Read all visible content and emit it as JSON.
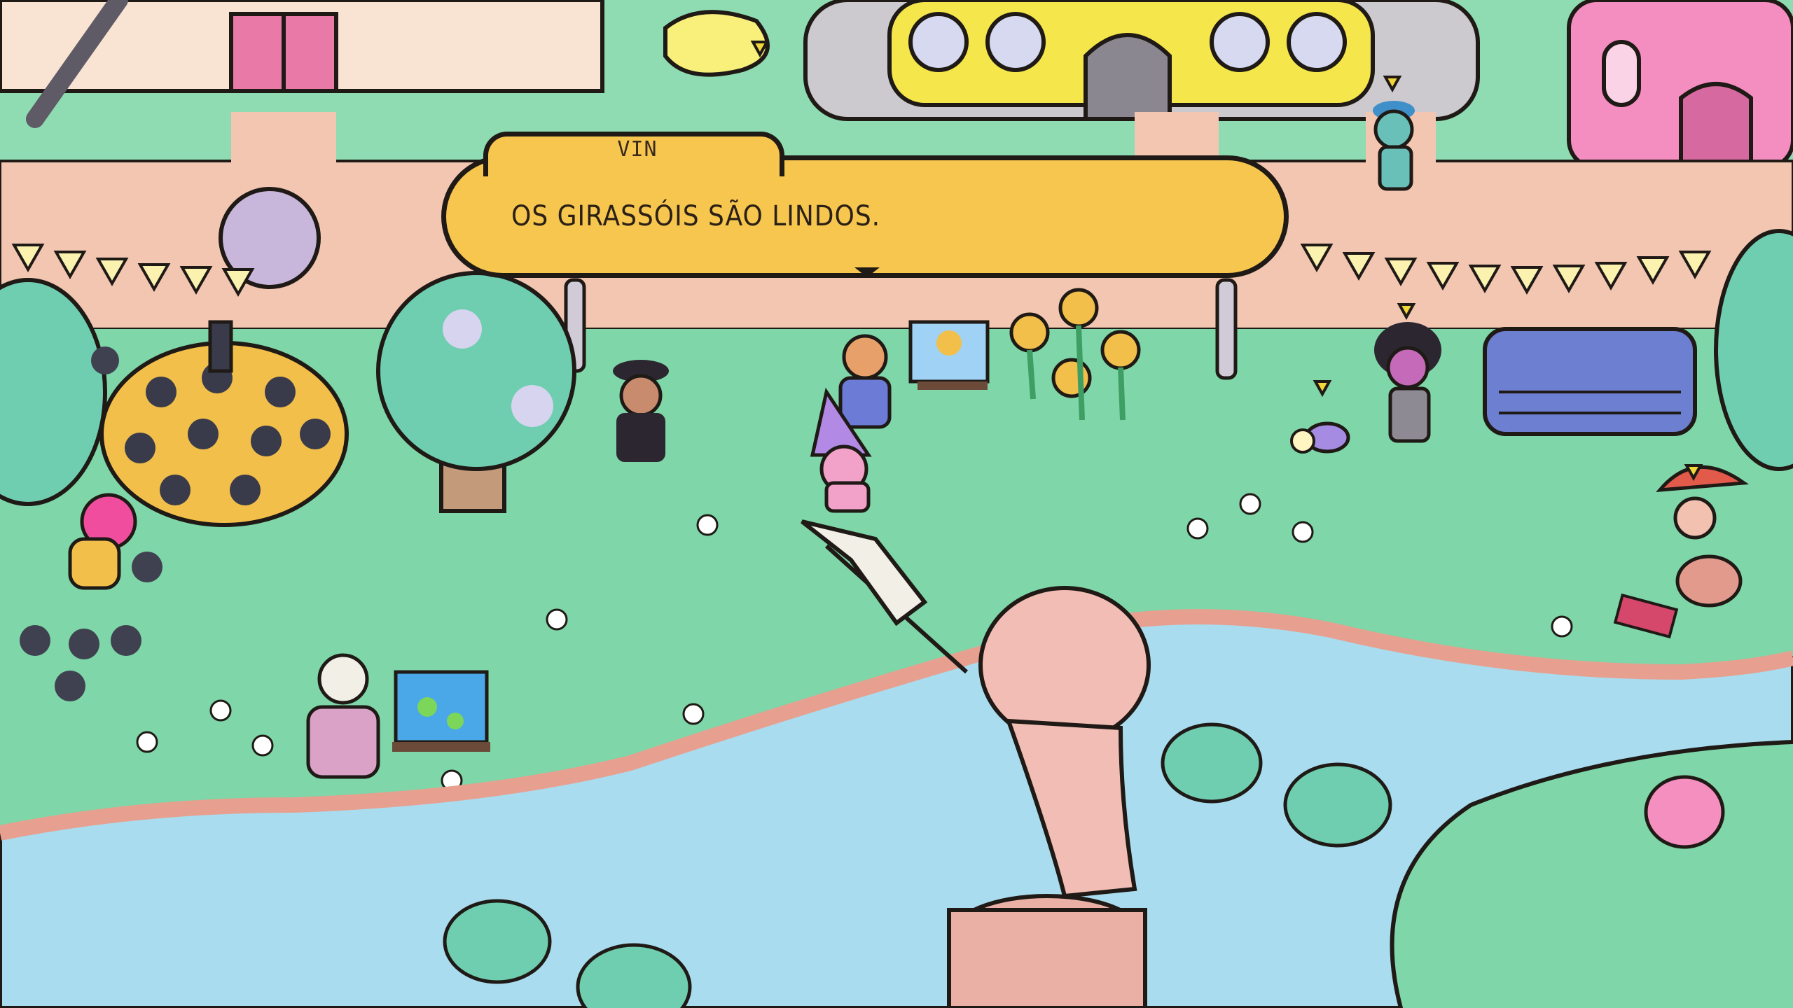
{
  "dialog": {
    "speaker": "VIN",
    "text": "OS GIRASSÓIS SÃO LINDOS."
  },
  "colors": {
    "grass": "#7fd6a8",
    "path": "#f3c6b2",
    "water": "#a9dcef",
    "dialog_bg": "#f7c64f",
    "outline": "#1f1a16"
  },
  "icons": {
    "advance": "down-triangle-icon",
    "npc_marker": "down-arrow-icon"
  }
}
